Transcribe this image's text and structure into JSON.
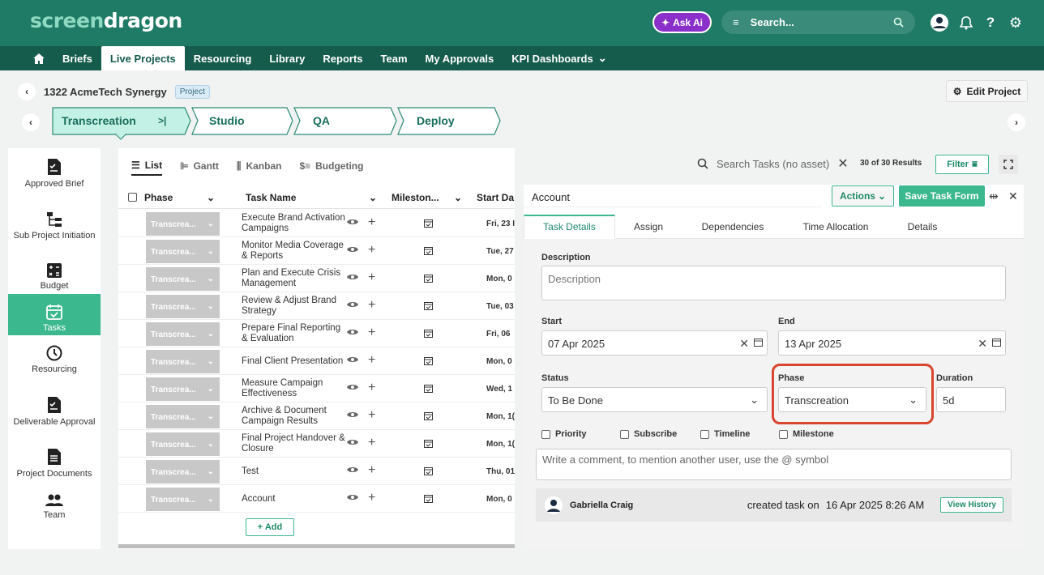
{
  "app": {
    "logo_part1": "screen",
    "logo_part2": "dragon",
    "ask_ai": "Ask Ai",
    "search_placeholder": "Search..."
  },
  "nav": {
    "items": [
      "Briefs",
      "Live Projects",
      "Resourcing",
      "Library",
      "Reports",
      "Team",
      "My Approvals",
      "KPI Dashboards"
    ],
    "active": "Live Projects"
  },
  "project": {
    "title": "1322 AcmeTech Synergy",
    "badge": "Project",
    "edit_label": "Edit Project"
  },
  "stages": [
    "Transcreation",
    "Studio",
    "QA",
    "Deploy"
  ],
  "sidebar": {
    "items": [
      {
        "label": "Approved Brief",
        "icon": "approved-brief-icon"
      },
      {
        "label": "Sub Project Initiation",
        "icon": "hierarchy-icon"
      },
      {
        "label": "Budget",
        "icon": "calculator-icon"
      },
      {
        "label": "Tasks",
        "icon": "calendar-check-icon"
      },
      {
        "label": "Resourcing",
        "icon": "clock-icon"
      },
      {
        "label": "Deliverable Approval",
        "icon": "approval-doc-icon"
      },
      {
        "label": "Project Documents",
        "icon": "document-icon"
      },
      {
        "label": "Team",
        "icon": "people-icon"
      }
    ],
    "active": "Tasks"
  },
  "views": [
    "List",
    "Gantt",
    "Kanban",
    "Budgeting"
  ],
  "table": {
    "columns": [
      "Phase",
      "Task Name",
      "Mileston...",
      "Start Da"
    ],
    "rows": [
      {
        "phase": "Transcrea...",
        "name": "Execute Brand Activation Campaigns",
        "start": "Fri, 23 I"
      },
      {
        "phase": "Transcrea...",
        "name": "Monitor Media Coverage & Reports",
        "start": "Tue, 27"
      },
      {
        "phase": "Transcrea...",
        "name": "Plan and Execute Crisis Management",
        "start": "Mon, 0"
      },
      {
        "phase": "Transcrea...",
        "name": "Review & Adjust Brand Strategy",
        "start": "Tue, 03"
      },
      {
        "phase": "Transcrea...",
        "name": "Prepare Final Reporting & Evaluation",
        "start": "Fri, 06"
      },
      {
        "phase": "Transcrea...",
        "name": "Final Client Presentation",
        "start": "Mon, 0"
      },
      {
        "phase": "Transcrea...",
        "name": "Measure Campaign Effectiveness",
        "start": "Wed, 1"
      },
      {
        "phase": "Transcrea...",
        "name": "Archive & Document Campaign Results",
        "start": "Mon, 1("
      },
      {
        "phase": "Transcrea...",
        "name": "Final Project Handover & Closure",
        "start": "Mon, 1("
      },
      {
        "phase": "Transcrea...",
        "name": "Test",
        "start": "Thu, 01"
      },
      {
        "phase": "Transcrea...",
        "name": "Account",
        "start": "Mon, 0"
      }
    ],
    "add_label": "+ Add"
  },
  "task_search": {
    "placeholder": "Search Tasks (no asset)",
    "results": "30 of 30 Results",
    "filter_label": "Filter"
  },
  "panel": {
    "title": "Account",
    "actions_label": "Actions",
    "save_label": "Save Task Form",
    "tabs": [
      "Task Details",
      "Assign",
      "Dependencies",
      "Time Allocation",
      "Details"
    ],
    "description_label": "Description",
    "description_placeholder": "Description",
    "start_label": "Start",
    "start_value": "07 Apr 2025",
    "end_label": "End",
    "end_value": "13 Apr 2025",
    "status_label": "Status",
    "status_value": "To Be Done",
    "phase_label": "Phase",
    "phase_value": "Transcreation",
    "duration_label": "Duration",
    "duration_value": "5d",
    "checkboxes": [
      "Priority",
      "Subscribe",
      "Timeline",
      "Milestone"
    ],
    "comment_placeholder": "Write a comment, to mention another user, use the @ symbol",
    "history_user": "Gabriella Craig",
    "history_action": "created task on",
    "history_date": "16 Apr 2025 8:26 AM",
    "view_history": "View History"
  },
  "colors": {
    "header": "#1f7a66",
    "nav": "#165c4d",
    "accent": "#3bb88d",
    "highlight": "#d9452f"
  }
}
